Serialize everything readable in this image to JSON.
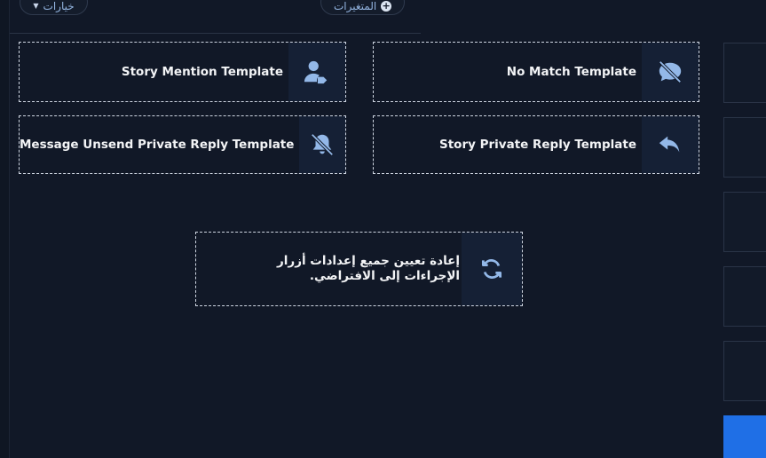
{
  "toolbar": {
    "options_label": "خيارات",
    "variables_label": "المتغيرات"
  },
  "cards": [
    {
      "label": "Story Mention Template",
      "icon": "user-at-icon"
    },
    {
      "label": "No Match Template",
      "icon": "comment-slash-icon"
    },
    {
      "label": "Message Unsend Private Reply Template",
      "icon": "bell-slash-icon"
    },
    {
      "label": "Story Private Reply Template",
      "icon": "reply-icon"
    }
  ],
  "reset": {
    "label": "إعادة تعيين جميع إعدادات أزرار الإجراءات إلى الافتراضي.",
    "icon": "sync-icon"
  },
  "colors": {
    "background": "#111827",
    "icon_accent": "#93b8e8",
    "primary_button": "#1f6fe6"
  }
}
